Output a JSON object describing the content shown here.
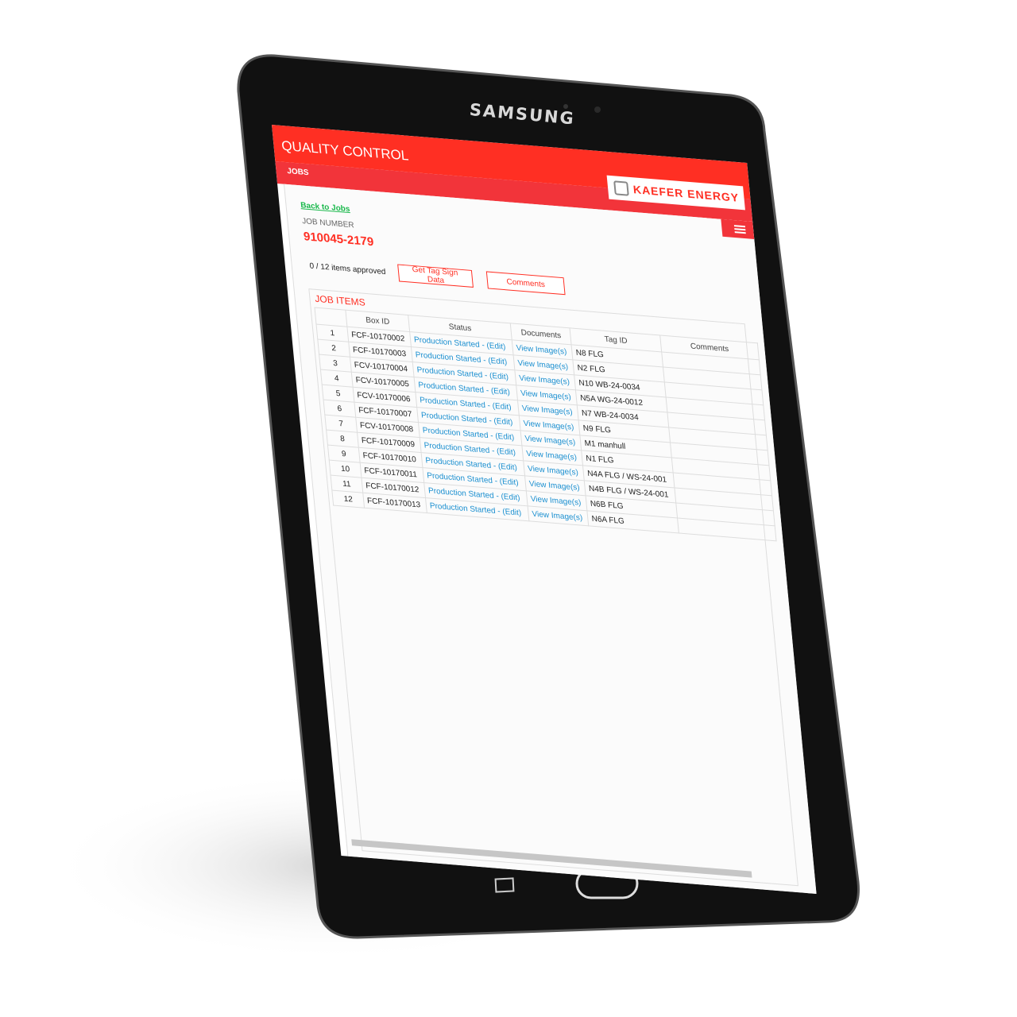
{
  "device": {
    "brand": "SAMSUNG"
  },
  "header": {
    "title": "QUALITY CONTROL",
    "section": "JOBS",
    "logo_text": "KAEFER ENERGY",
    "menu_icon": "hamburger-icon"
  },
  "page": {
    "back_link": "Back to Jobs",
    "job_number_label": "JOB NUMBER",
    "job_number": "910045-2179",
    "approved": "0 / 12 items approved",
    "get_tag_button": "Get Tag Sign Data",
    "comments_button": "Comments",
    "job_items_title": "JOB ITEMS"
  },
  "table": {
    "headers": [
      "",
      "Box ID",
      "Status",
      "Documents",
      "Tag ID",
      "Comments"
    ],
    "rows": [
      {
        "n": "1",
        "box": "FCF-10170002",
        "status": "Production Started - (Edit)",
        "doc": "View Image(s)",
        "tag": "N8 FLG",
        "comments": ""
      },
      {
        "n": "2",
        "box": "FCF-10170003",
        "status": "Production Started - (Edit)",
        "doc": "View Image(s)",
        "tag": "N2 FLG",
        "comments": ""
      },
      {
        "n": "3",
        "box": "FCV-10170004",
        "status": "Production Started - (Edit)",
        "doc": "View Image(s)",
        "tag": "N10 WB-24-0034",
        "comments": ""
      },
      {
        "n": "4",
        "box": "FCV-10170005",
        "status": "Production Started - (Edit)",
        "doc": "View Image(s)",
        "tag": "N5A WG-24-0012",
        "comments": ""
      },
      {
        "n": "5",
        "box": "FCV-10170006",
        "status": "Production Started - (Edit)",
        "doc": "View Image(s)",
        "tag": "N7 WB-24-0034",
        "comments": ""
      },
      {
        "n": "6",
        "box": "FCF-10170007",
        "status": "Production Started - (Edit)",
        "doc": "View Image(s)",
        "tag": "N9 FLG",
        "comments": ""
      },
      {
        "n": "7",
        "box": "FCV-10170008",
        "status": "Production Started - (Edit)",
        "doc": "View Image(s)",
        "tag": "M1 manhull",
        "comments": ""
      },
      {
        "n": "8",
        "box": "FCF-10170009",
        "status": "Production Started - (Edit)",
        "doc": "View Image(s)",
        "tag": "N1 FLG",
        "comments": ""
      },
      {
        "n": "9",
        "box": "FCF-10170010",
        "status": "Production Started - (Edit)",
        "doc": "View Image(s)",
        "tag": "N4A FLG / WS-24-001",
        "comments": ""
      },
      {
        "n": "10",
        "box": "FCF-10170011",
        "status": "Production Started - (Edit)",
        "doc": "View Image(s)",
        "tag": "N4B FLG / WS-24-001",
        "comments": ""
      },
      {
        "n": "11",
        "box": "FCF-10170012",
        "status": "Production Started - (Edit)",
        "doc": "View Image(s)",
        "tag": "N6B FLG",
        "comments": ""
      },
      {
        "n": "12",
        "box": "FCF-10170013",
        "status": "Production Started - (Edit)",
        "doc": "View Image(s)",
        "tag": "N6A FLG",
        "comments": ""
      }
    ]
  },
  "colors": {
    "accent": "#ff2f23",
    "link": "#1a8fd0",
    "back_link": "#18b84a"
  }
}
